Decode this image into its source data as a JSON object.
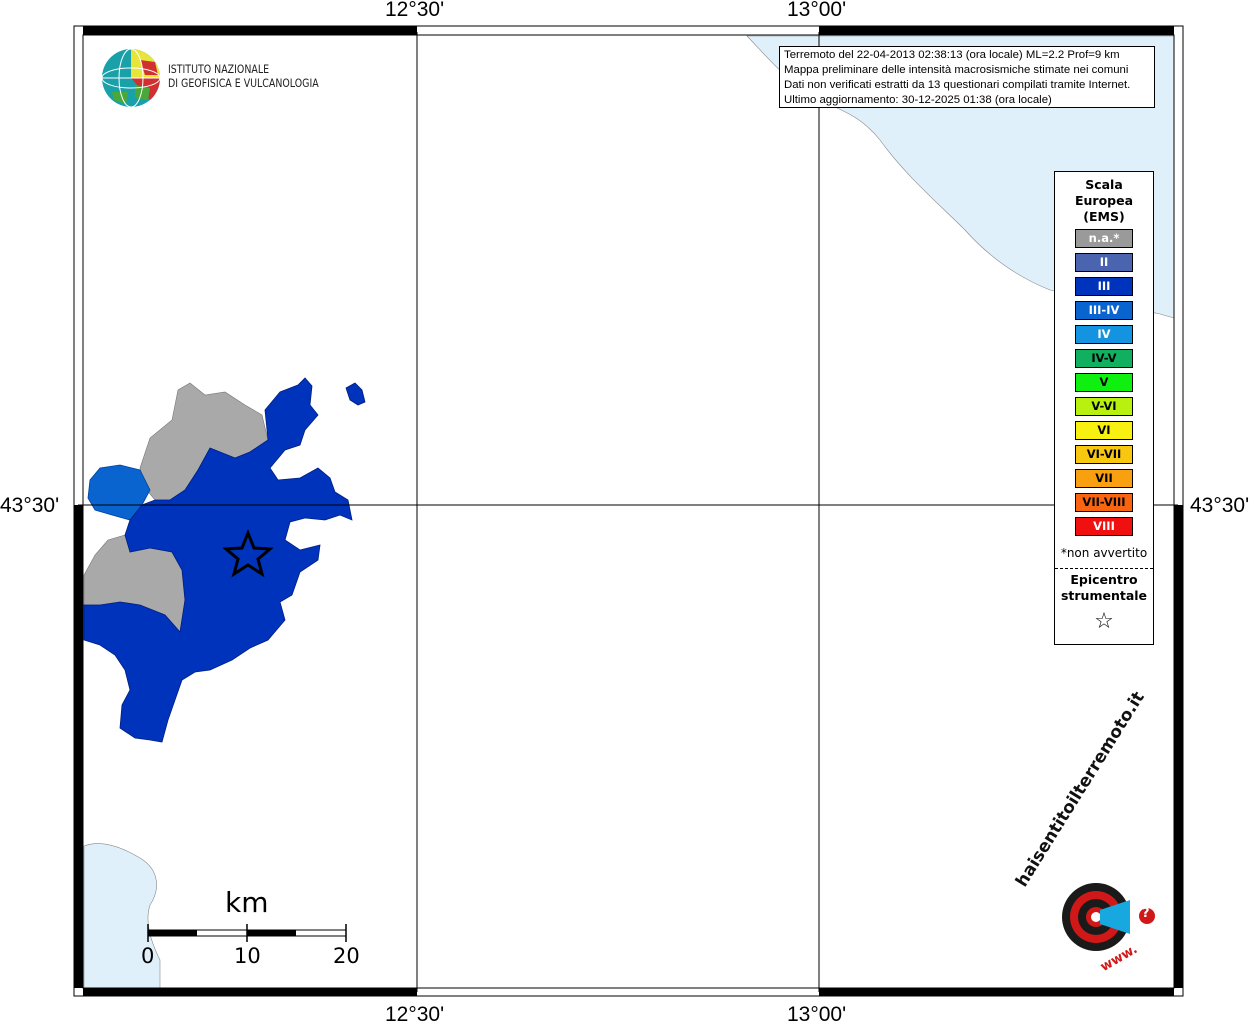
{
  "map": {
    "top_labels": [
      "12°30'",
      "13°00'"
    ],
    "bottom_labels": [
      "12°30'",
      "13°00'"
    ],
    "left_label": "43°30'",
    "right_label": "43°30'",
    "sea_color": "#dff0fb",
    "colors": {
      "na": "#a9a9a9",
      "III": "#0033bb",
      "III_IV": "#0a64d0"
    }
  },
  "info_box": {
    "line1": "Terremoto del 22-04-2013 02:38:13 (ora locale) ML=2.2 Prof=9 km",
    "line2": "Mappa preliminare delle intensità macrosismiche stimate nei comuni",
    "line3": "Dati non verificati estratti da 13 questionari compilati tramite Internet.",
    "line4": "Ultimo aggiornamento: 30-12-2025 01:38 (ora locale)"
  },
  "logo": {
    "line1": "ISTITUTO NAZIONALE",
    "line2": "DI GEOFISICA E VULCANOLOGIA"
  },
  "legend": {
    "title1": "Scala",
    "title2": "Europea",
    "title3": "(EMS)",
    "items": [
      {
        "label": "n.a.*",
        "color": "#9a9a9a",
        "text": "#ffffff"
      },
      {
        "label": "II",
        "color": "#4a64b0",
        "text": "#ffffff"
      },
      {
        "label": "III",
        "color": "#0033bb",
        "text": "#ffffff"
      },
      {
        "label": "III-IV",
        "color": "#0a64d0",
        "text": "#ffffff"
      },
      {
        "label": "IV",
        "color": "#1494e0",
        "text": "#ffffff"
      },
      {
        "label": "IV-V",
        "color": "#10b060",
        "text": "#000000"
      },
      {
        "label": "V",
        "color": "#10f010",
        "text": "#000000"
      },
      {
        "label": "V-VI",
        "color": "#b8f010",
        "text": "#000000"
      },
      {
        "label": "VI",
        "color": "#f8f010",
        "text": "#000000"
      },
      {
        "label": "VI-VII",
        "color": "#f8c810",
        "text": "#000000"
      },
      {
        "label": "VII",
        "color": "#f8a010",
        "text": "#000000"
      },
      {
        "label": "VII-VIII",
        "color": "#f86410",
        "text": "#000000"
      },
      {
        "label": "VIII",
        "color": "#f01010",
        "text": "#ffffff"
      }
    ],
    "note": "*non avvertito",
    "epicentre1": "Epicentro",
    "epicentre2": "strumentale",
    "epicentre_symbol": "☆"
  },
  "scale_bar": {
    "unit": "km",
    "ticks": [
      "0",
      "10",
      "20"
    ]
  },
  "hsit_logo": {
    "text": "haisentitoilterremoto.it",
    "url_text": "www.",
    "question": "?"
  }
}
